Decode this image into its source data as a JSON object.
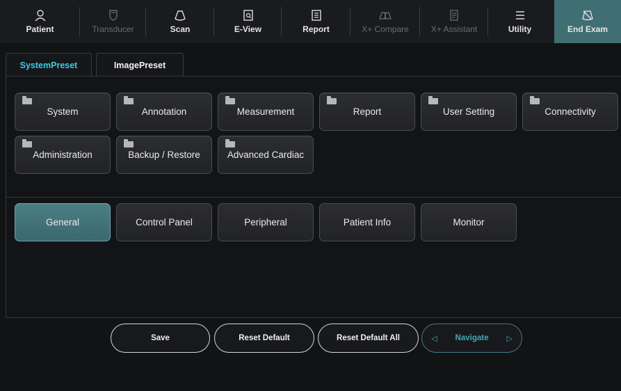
{
  "toolbar": {
    "items": [
      {
        "label": "Patient",
        "icon": "patient-icon",
        "enabled": true
      },
      {
        "label": "Transducer",
        "icon": "transducer-icon",
        "enabled": false
      },
      {
        "label": "Scan",
        "icon": "scan-icon",
        "enabled": true
      },
      {
        "label": "E-View",
        "icon": "e-view-icon",
        "enabled": true
      },
      {
        "label": "Report",
        "icon": "report-icon",
        "enabled": true
      },
      {
        "label": "X+ Compare",
        "icon": "compare-icon",
        "enabled": false
      },
      {
        "label": "X+ Assistant",
        "icon": "assistant-icon",
        "enabled": false
      },
      {
        "label": "Utility",
        "icon": "menu-icon",
        "enabled": true
      },
      {
        "label": "End Exam",
        "icon": "end-exam-icon",
        "enabled": true,
        "accent": "#3f6f73"
      }
    ]
  },
  "tabs": [
    {
      "label": "SystemPreset",
      "active": true
    },
    {
      "label": "ImagePreset",
      "active": false
    }
  ],
  "categories": [
    {
      "label": "System"
    },
    {
      "label": "Annotation"
    },
    {
      "label": "Measurement"
    },
    {
      "label": "Report"
    },
    {
      "label": "User Setting"
    },
    {
      "label": "Connectivity"
    },
    {
      "label": "Administration"
    },
    {
      "label": "Backup / Restore"
    },
    {
      "label": "Advanced Cardiac"
    }
  ],
  "subcategories": [
    {
      "label": "General",
      "active": true
    },
    {
      "label": "Control Panel",
      "active": false
    },
    {
      "label": "Peripheral",
      "active": false
    },
    {
      "label": "Patient Info",
      "active": false
    },
    {
      "label": "Monitor",
      "active": false
    }
  ],
  "actions": {
    "save": "Save",
    "reset_default": "Reset Default",
    "reset_default_all": "Reset Default All",
    "navigate": "Navigate"
  },
  "colors": {
    "accent_cyan": "#3ec9e0",
    "active_button": "#3f7a7f",
    "end_exam_bg": "#3f6f73"
  }
}
